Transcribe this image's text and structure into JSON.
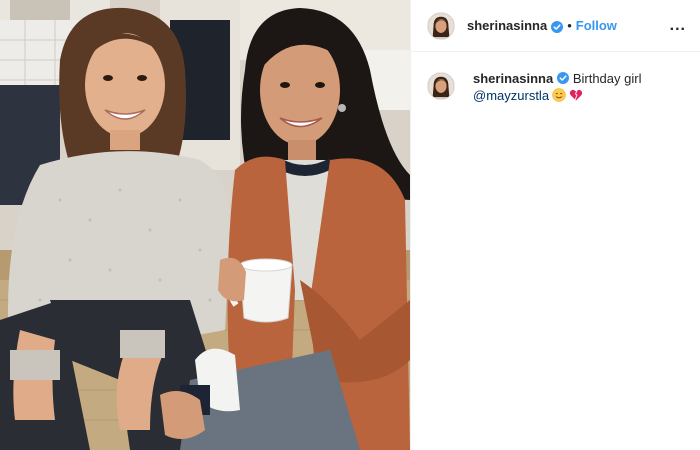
{
  "post": {
    "username": "sherinasinna",
    "separator": "•",
    "follow_label": "Follow",
    "more_label": "...",
    "verified_icon": "verified-badge-icon"
  },
  "caption": {
    "username": "sherinasinna",
    "text": "Birthday girl",
    "mention": "@mayzurstla",
    "emojis": [
      "smiling-face-icon",
      "heart-icon"
    ]
  },
  "photo": {
    "description_icon": "post-photo"
  },
  "colors": {
    "link_blue": "#3897f0",
    "mention_blue": "#003569",
    "verified_blue": "#3897f0",
    "heart_red": "#e0245e"
  }
}
